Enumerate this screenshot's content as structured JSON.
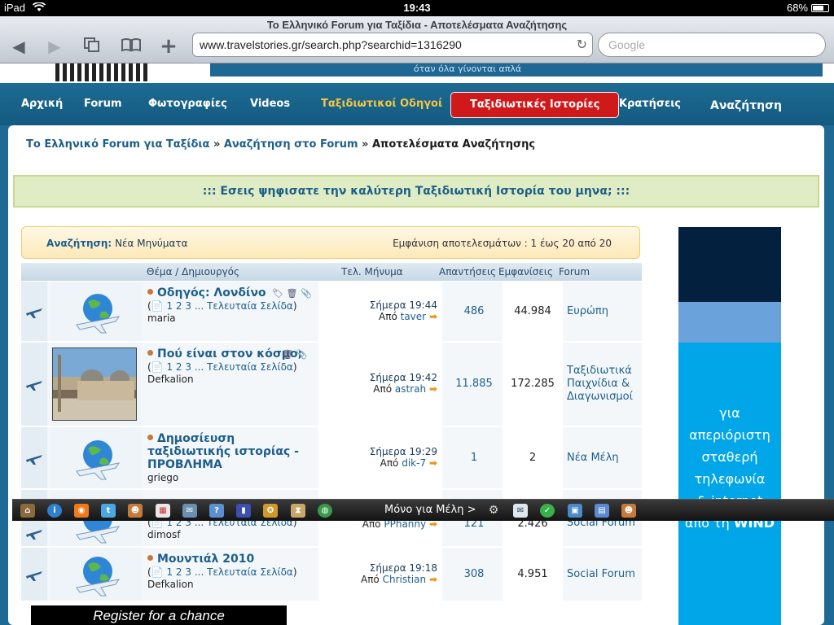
{
  "status": {
    "device": "iPad",
    "time": "19:43",
    "battery": "68%"
  },
  "browser": {
    "page_title": "Το Ελληνικό Forum για Ταξίδια - Αποτελέσματα Αναζήτησης",
    "url": "www.travelstories.gr/search.php?searchid=1316290",
    "search_placeholder": "Google"
  },
  "site": {
    "slogan": "όταν όλα γίνονται απλά"
  },
  "nav": [
    {
      "label": "Αρχική"
    },
    {
      "label": "Forum"
    },
    {
      "label": "Φωτογραφίες"
    },
    {
      "label": "Videos"
    },
    {
      "label": "Ταξιδιωτικοί Οδηγοί"
    },
    {
      "label": "Ταξιδιωτικές Ιστορίες"
    },
    {
      "label": "Κρατήσεις"
    },
    {
      "label": "Αναζήτηση"
    }
  ],
  "breadcrumb": {
    "home": "Το Ελληνικό Forum για Ταξίδια",
    "search": "Αναζήτηση στο Forum",
    "current": "Αποτελέσματα Αναζήτησης",
    "sep": "»"
  },
  "poll_banner": "::: Εσεις ψηφισατε την καλύτερη Ταξιδιωτική Ιστορία του μηνα; :::",
  "search_summary": {
    "label": "Αναζήτηση:",
    "value": "Νέα Μηνύματα",
    "count": "Εμφάνιση αποτελεσμάτων : 1 έως 20 από 20"
  },
  "table": {
    "headers": {
      "topic": "Θέμα / Δημιουργός",
      "last": "Τελ. Μήνυμα",
      "replies": "Απαντήσεις",
      "views": "Εμφανίσεις",
      "forum": "Forum"
    },
    "pages_prefix": "(",
    "pages_links": "1 2 3 ...",
    "last_page_label": "Τελευταία Σελίδα",
    "pages_suffix": ")",
    "by_prefix": "Από",
    "arrow": "➡",
    "rows": [
      {
        "title": "Οδηγός: Λονδίνο",
        "author": "maria",
        "last_time": "Σήμερα 19:44",
        "last_user": "taver",
        "replies": "486",
        "views": "44.984",
        "forum": "Ευρώπη"
      },
      {
        "title": "Πού είναι στον κόσμο;",
        "author": "Defkalion",
        "last_time": "Σήμερα 19:42",
        "last_user": "astrah",
        "replies": "11.885",
        "views": "172.285",
        "forum": "Ταξιδιωτικά Παιχνίδια & Διαγωνισμοί"
      },
      {
        "title": "Δημοσίευση ταξιδιωτικής ιστορίας - ΠΡΟΒΛΗΜΑ",
        "author": "griego",
        "last_time": "Σήμερα 19:29",
        "last_user": "dik-7",
        "replies": "1",
        "views": "2",
        "forum": "Νέα Μέλη"
      },
      {
        "author": "dimosf",
        "last_user": "PPhanny",
        "replies": "121",
        "views": "2.426",
        "forum": "Social Forum"
      },
      {
        "title": "Μουντιάλ 2010",
        "author": "Defkalion",
        "last_time": "Σήμερα 19:18",
        "last_user": "Christian",
        "replies": "308",
        "views": "4.951",
        "forum": "Social Forum"
      }
    ]
  },
  "ad": {
    "line1": "για",
    "line2": "απεριόριστη",
    "line3": "σταθερή",
    "line4": "τηλεφωνία",
    "line5": "& internet",
    "line6": "από τη",
    "brand": "WIND"
  },
  "register_banner": "Register for a chance",
  "toolbar": {
    "members_label": "Μόνο για Μέλη >",
    "icons": [
      "home-icon",
      "info-icon",
      "rss-icon",
      "twitter-icon",
      "users-icon",
      "calendar-icon",
      "chat-icon",
      "help-icon",
      "stats-icon",
      "award-icon",
      "hourglass-icon",
      "globe-icon",
      "gear-icon",
      "mail-icon",
      "check-icon",
      "photo-icon",
      "book-icon",
      "user-icon"
    ]
  }
}
